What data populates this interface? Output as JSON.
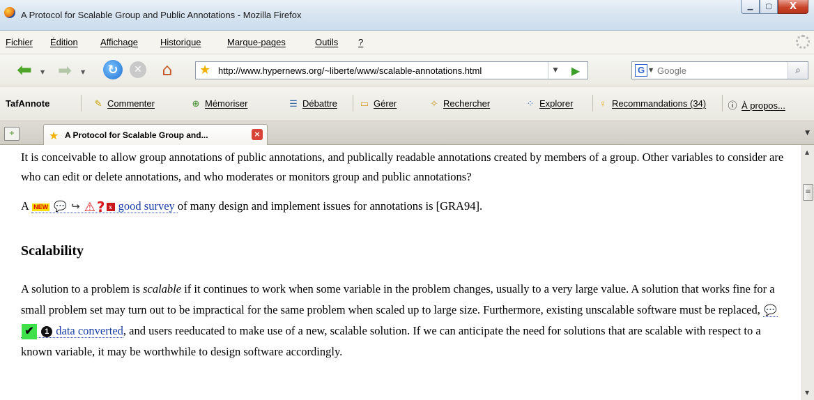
{
  "window": {
    "title": "A Protocol for Scalable Group and Public Annotations - Mozilla Firefox",
    "minimize_icon": "minimize-icon",
    "maximize_icon": "maximize-icon",
    "close_label": "X"
  },
  "menubar": {
    "items": [
      {
        "label": "Fichier"
      },
      {
        "label": "Édition"
      },
      {
        "label": "Affichage"
      },
      {
        "label": "Historique"
      },
      {
        "label": "Marque-pages"
      },
      {
        "label": "Outils"
      },
      {
        "label": "?"
      }
    ]
  },
  "navbar": {
    "url": "http://www.hypernews.org/~liberte/www/scalable-annotations.html",
    "search_engine": "G",
    "search_placeholder": "Google"
  },
  "tafbar": {
    "brand": "TafAnnote",
    "buttons": [
      {
        "label": "Commenter",
        "icon": "pencil-icon"
      },
      {
        "label": "Mémoriser",
        "icon": "bookmark-add-icon"
      },
      {
        "label": "Débattre",
        "icon": "debate-icon"
      },
      {
        "label": "Gérer",
        "icon": "folder-icon"
      },
      {
        "label": "Rechercher",
        "icon": "search-wand-icon"
      },
      {
        "label": "Explorer",
        "icon": "explore-icon"
      },
      {
        "label": "Recommandations (34)",
        "icon": "lightbulb-icon"
      },
      {
        "label": "À propos...",
        "icon": "help-icon"
      }
    ]
  },
  "tabs": [
    {
      "label": "A Protocol for Scalable Group and...",
      "active": true
    }
  ],
  "content": {
    "p1": "It is conceivable to allow group annotations of public annotations, and publically readable annotations created by members of a group. Other variables to consider are who can edit or delete annotations, and who moderates or monitors group and public annotations?",
    "p2_prefix": "A",
    "p2_new_badge": "NEW",
    "p2_link": "good survey",
    "p2_suffix": "of many design and implement issues for annotations is [GRA94].",
    "heading": "Scalability",
    "p3_a": "A solution to a problem is",
    "p3_em": "scalable",
    "p3_b": "if it continues to work when some variable in the problem changes, usually to a very large value. A solution that works fine for a small problem set may turn out to be impractical for the same problem when scaled up to large size. Furthermore, existing unscalable software must be replaced,",
    "p3_info": "1",
    "p3_link": "data converted",
    "p3_c": ", and users reeducated to make use of a new, scalable solution. If we can anticipate the need for solutions that are scalable with respect to a known variable, it may be worthwhile to design software accordingly."
  },
  "colors": {
    "link": "#1a3fa6",
    "new_badge_bg": "#ffe000",
    "check_bg": "#3fe04a",
    "warning": "#d61a1a"
  }
}
